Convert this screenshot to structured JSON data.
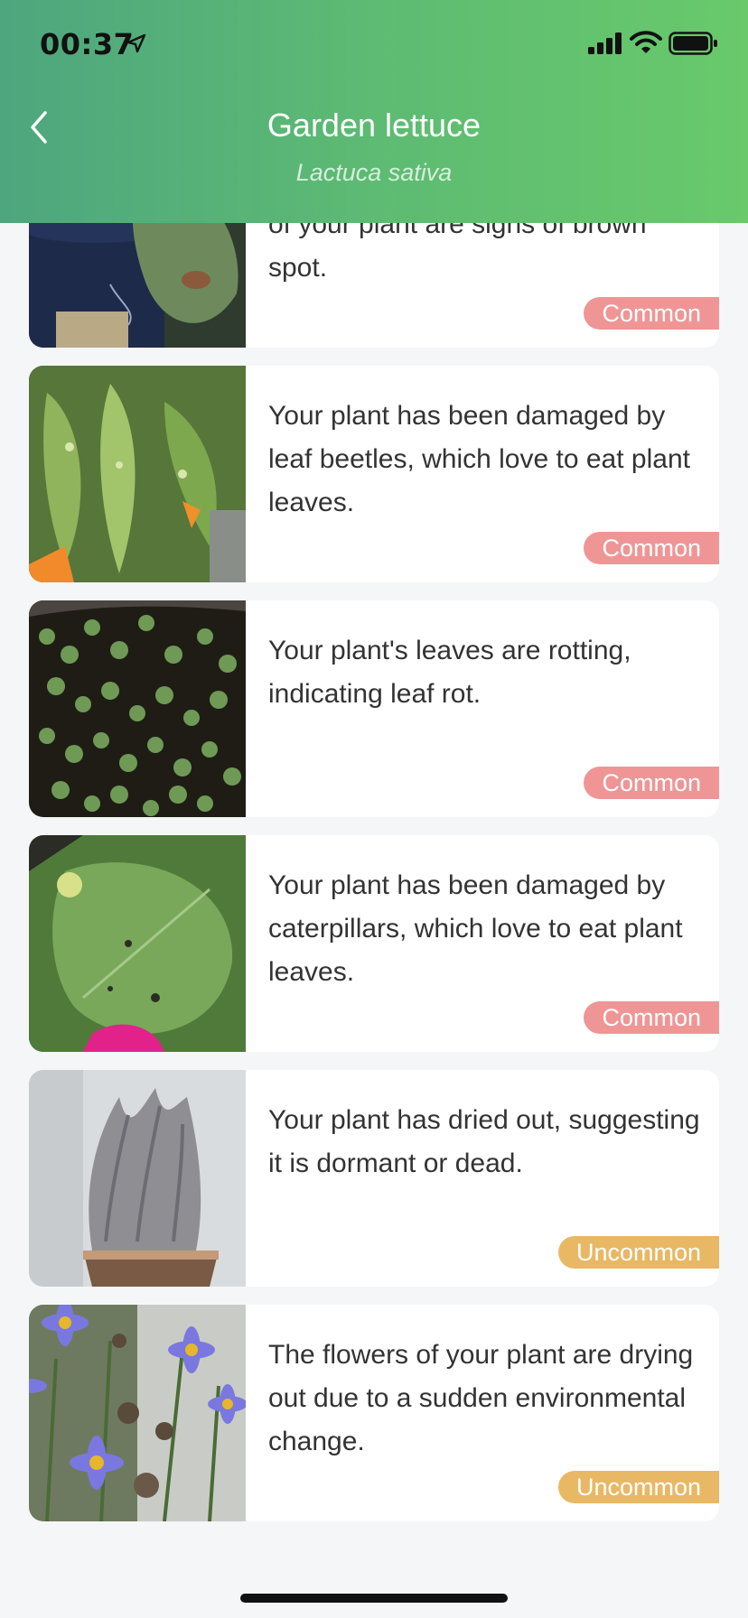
{
  "status_bar": {
    "time": "00:37"
  },
  "nav": {
    "title": "Garden lettuce",
    "subtitle": "Lactuca sativa"
  },
  "issues": [
    {
      "text": "of your plant are signs of brown spot.",
      "badge": "Common",
      "severity": "common"
    },
    {
      "text": "Your plant has been damaged by leaf beetles, which love to eat plant leaves.",
      "badge": "Common",
      "severity": "common"
    },
    {
      "text": "Your plant's leaves are rotting, indicating leaf rot.",
      "badge": "Common",
      "severity": "common"
    },
    {
      "text": "Your plant has been damaged by caterpillars, which love to eat plant leaves.",
      "badge": "Common",
      "severity": "common"
    },
    {
      "text": "Your plant has dried out, suggesting it is dormant or dead.",
      "badge": "Uncommon",
      "severity": "uncommon"
    },
    {
      "text": "The flowers of your plant are drying out due to a sudden environmental change.",
      "badge": "Uncommon",
      "severity": "uncommon"
    }
  ],
  "colors": {
    "common": "#ef9595",
    "uncommon": "#e8b864",
    "header_start": "#4ea67e",
    "header_end": "#69c96b"
  }
}
